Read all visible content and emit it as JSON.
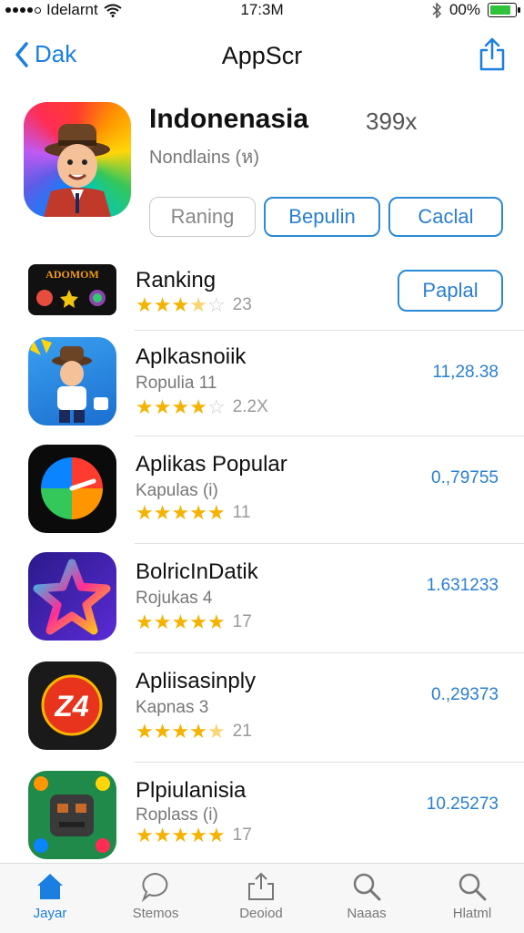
{
  "status": {
    "carrier": "Idelarnt",
    "time": "17:3M",
    "battery": "00%"
  },
  "nav": {
    "back_label": "Dak",
    "title": "AppScr"
  },
  "hero": {
    "name": "Indonenasia",
    "size": "399x",
    "subtitle": "Nondlains (ห)",
    "buttons": [
      "Raning",
      "Bepulin",
      "Caclal"
    ]
  },
  "ranking": {
    "name": "Ranking",
    "rating": 3.5,
    "count": "23",
    "button": "Paplal",
    "icon_text": "ADOMOM"
  },
  "apps": [
    {
      "name": "Aplkasnoiik",
      "sub": "Ropulia 11",
      "rating": 4,
      "count": "2.2X",
      "price": "11,28.38",
      "icon": "explorer-character-icon"
    },
    {
      "name": "Aplikas Popular",
      "sub": "Kapulas (i)",
      "rating": 5,
      "count": "11",
      "price": "0.,79755",
      "icon": "color-wheel-icon"
    },
    {
      "name": "BolricInDatik",
      "sub": "Rojukas 4",
      "rating": 5,
      "count": "17",
      "price": "1.631233",
      "icon": "star-logo-icon"
    },
    {
      "name": "Apliisasinply",
      "sub": "Kapnas 3",
      "rating": 4.5,
      "count": "21",
      "price": "0.,29373",
      "icon": "z4-logo-icon"
    },
    {
      "name": "Plpiulanisia",
      "sub": "Roplass (i)",
      "rating": 5,
      "count": "17",
      "price": "10.25273",
      "icon": "robot-game-icon"
    }
  ],
  "tabs": [
    {
      "label": "Jayar",
      "icon": "home-icon",
      "active": true
    },
    {
      "label": "Stemos",
      "icon": "chat-bubble-icon",
      "active": false
    },
    {
      "label": "Deoiod",
      "icon": "share-box-icon",
      "active": false
    },
    {
      "label": "Naaas",
      "icon": "search-icon",
      "active": false
    },
    {
      "label": "Hlatml",
      "icon": "search-icon",
      "active": false
    }
  ],
  "colors": {
    "accent": "#1a7fe0",
    "star": "#f5b301",
    "battery": "#2ec339"
  }
}
